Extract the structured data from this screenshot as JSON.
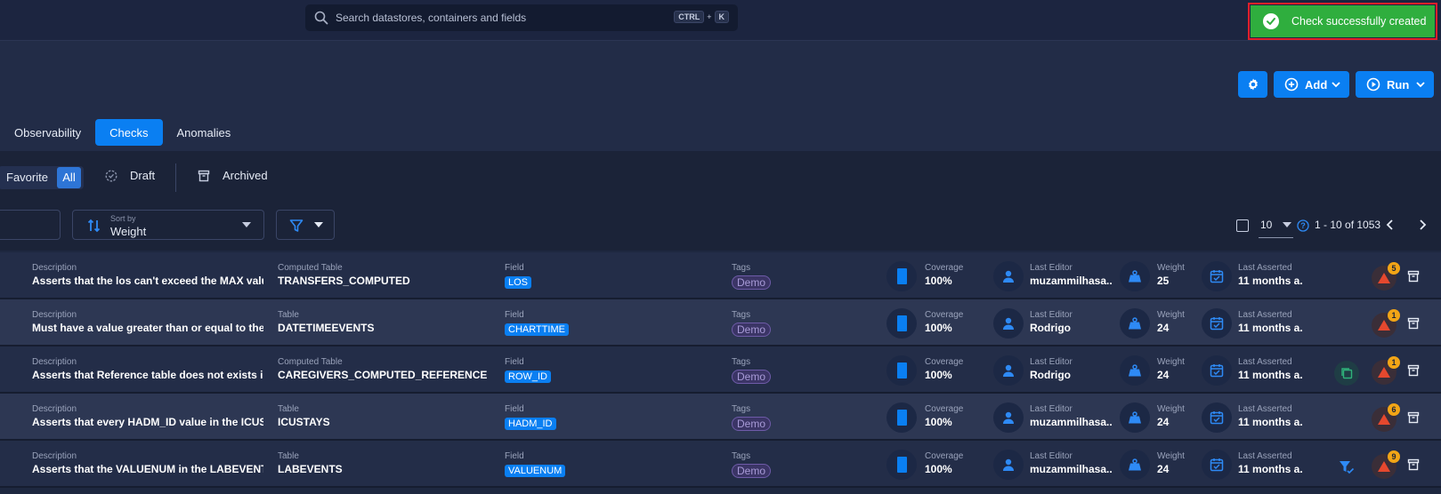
{
  "search": {
    "placeholder": "Search datastores, containers and fields",
    "kbd_ctrl": "CTRL",
    "kbd_plus": "+",
    "kbd_k": "K"
  },
  "toast": {
    "message": "Check successfully created"
  },
  "actions": {
    "add_label": "Add",
    "run_label": "Run"
  },
  "tabs": [
    {
      "label": "Observability",
      "active": false
    },
    {
      "label": "Checks",
      "active": true
    },
    {
      "label": "Anomalies",
      "active": false
    }
  ],
  "status_filter": {
    "favorite_label": "Favorite",
    "all_label": "All",
    "draft_label": "Draft",
    "archived_label": "Archived"
  },
  "sort": {
    "caption": "Sort by",
    "value": "Weight"
  },
  "pagination": {
    "per_page": "10",
    "range": "1 - 10 of 1053"
  },
  "labels": {
    "description": "Description",
    "field": "Field",
    "tags": "Tags",
    "coverage": "Coverage",
    "last_editor": "Last Editor",
    "weight": "Weight",
    "last_asserted": "Last Asserted"
  },
  "rows": [
    {
      "description": "Asserts that the los can't exceed the MAX valu...",
      "table_label": "Computed Table",
      "table": "TRANSFERS_COMPUTED",
      "field": "LOS",
      "tag": "Demo",
      "coverage": "100%",
      "editor": "muzammilhasa...",
      "weight": "25",
      "asserted": "11 months a...",
      "anomalies": "5",
      "extra": ""
    },
    {
      "description": "Must have a value greater than or equal to the ...",
      "table_label": "Table",
      "table": "DATETIMEEVENTS",
      "field": "CHARTTIME",
      "tag": "Demo",
      "coverage": "100%",
      "editor": "Rodrigo",
      "weight": "24",
      "asserted": "11 months a...",
      "anomalies": "1",
      "extra": ""
    },
    {
      "description": "Asserts that Reference table does not exists i...",
      "table_label": "Computed Table",
      "table": "CAREGIVERS_COMPUTED_REFERENCE",
      "field": "ROW_ID",
      "tag": "Demo",
      "coverage": "100%",
      "editor": "Rodrigo",
      "weight": "24",
      "asserted": "11 months a...",
      "anomalies": "1",
      "extra": "copy-icon"
    },
    {
      "description": "Asserts that every HADM_ID value in the ICUS...",
      "table_label": "Table",
      "table": "ICUSTAYS",
      "field": "HADM_ID",
      "tag": "Demo",
      "coverage": "100%",
      "editor": "muzammilhasa...",
      "weight": "24",
      "asserted": "11 months a...",
      "anomalies": "6",
      "extra": ""
    },
    {
      "description": "Asserts that the VALUENUM in the LABEVENTS...",
      "table_label": "Table",
      "table": "LABEVENTS",
      "field": "VALUENUM",
      "tag": "Demo",
      "coverage": "100%",
      "editor": "muzammilhasa...",
      "weight": "24",
      "asserted": "11 months a...",
      "anomalies": "9",
      "extra": "filter-check-icon"
    }
  ],
  "colors": {
    "accent": "#0a7ff2",
    "success": "#2fae3e",
    "warning": "#f2a516",
    "danger": "#e5482e"
  }
}
